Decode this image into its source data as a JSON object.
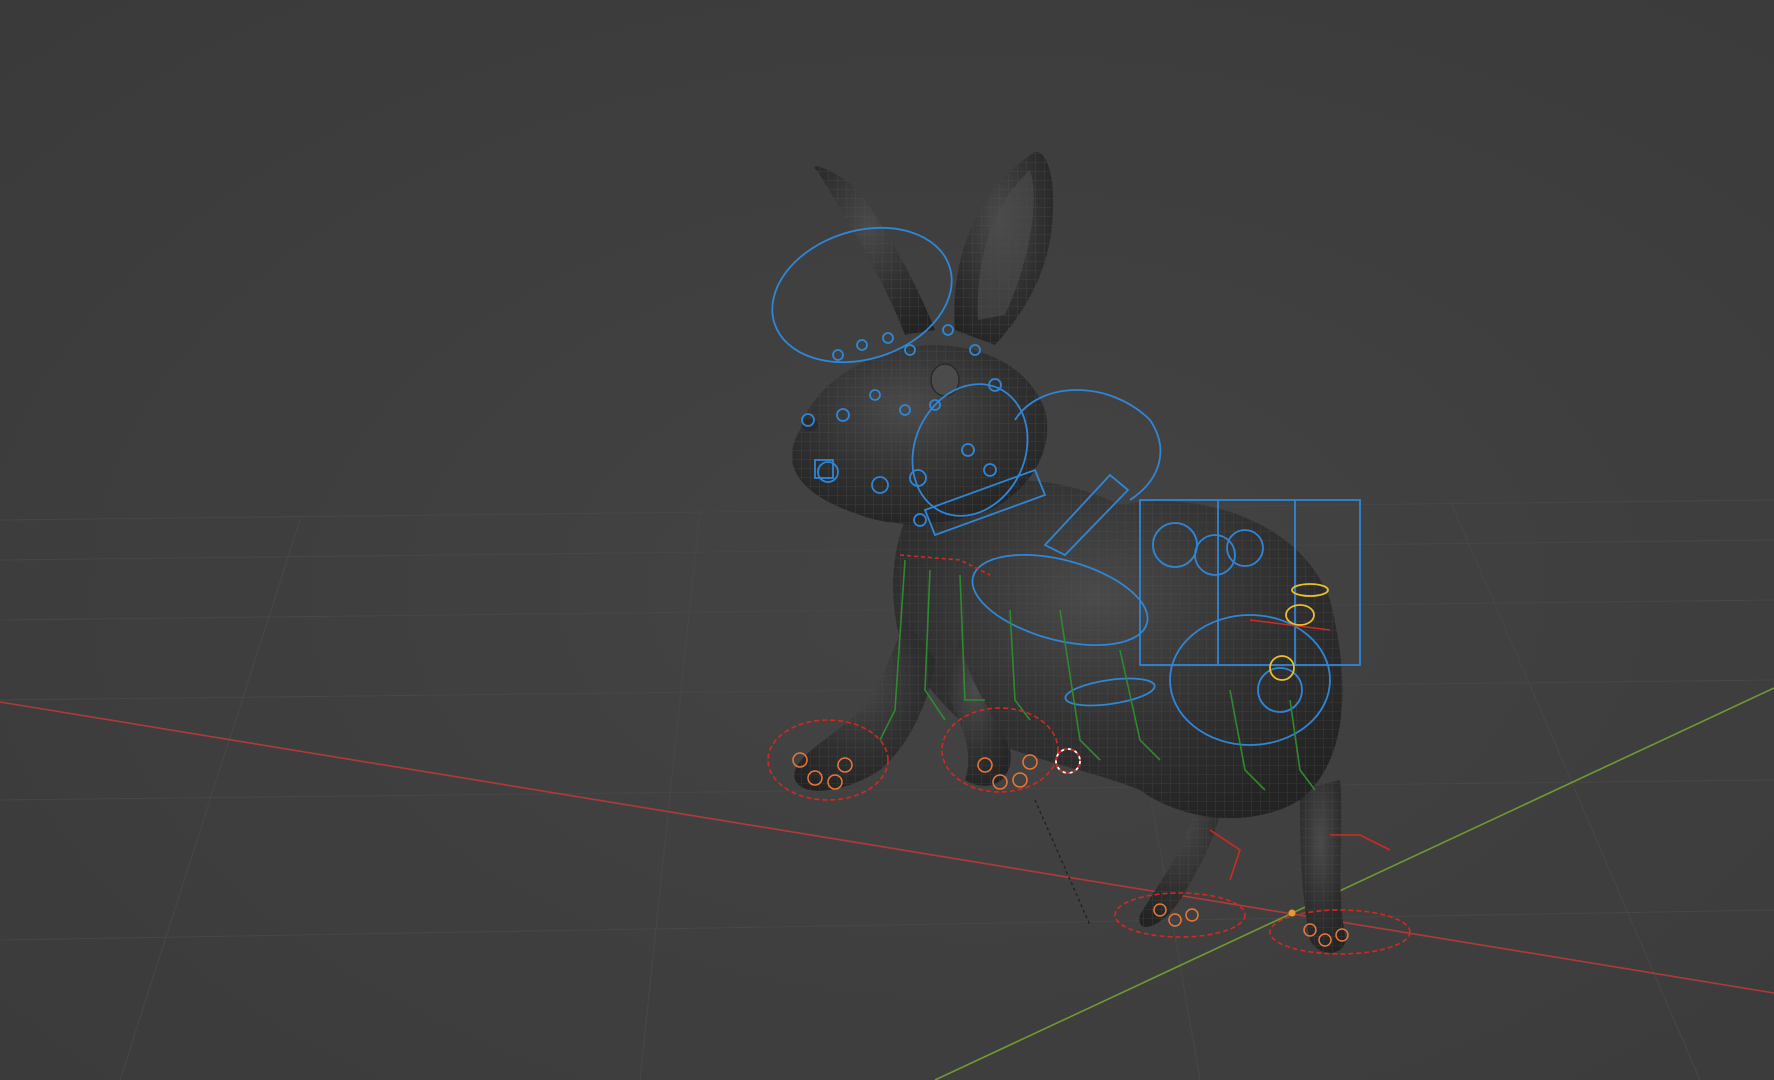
{
  "viewport": {
    "background_color": "#3d3d3d",
    "grid_color": "#4a4a4a",
    "x_axis_color": "#b03a3a",
    "y_axis_color": "#6f9a32"
  },
  "model": {
    "subject": "rabbit",
    "mesh_color": "#2e2e2e",
    "wire_color": "#575757"
  },
  "rig": {
    "body_control_color": "#2f86d6",
    "ik_control_color": "#d02a22",
    "fk_control_color": "#2e8a2e",
    "foot_detail_color": "#e8783a",
    "tail_control_color": "#e8c02a"
  }
}
